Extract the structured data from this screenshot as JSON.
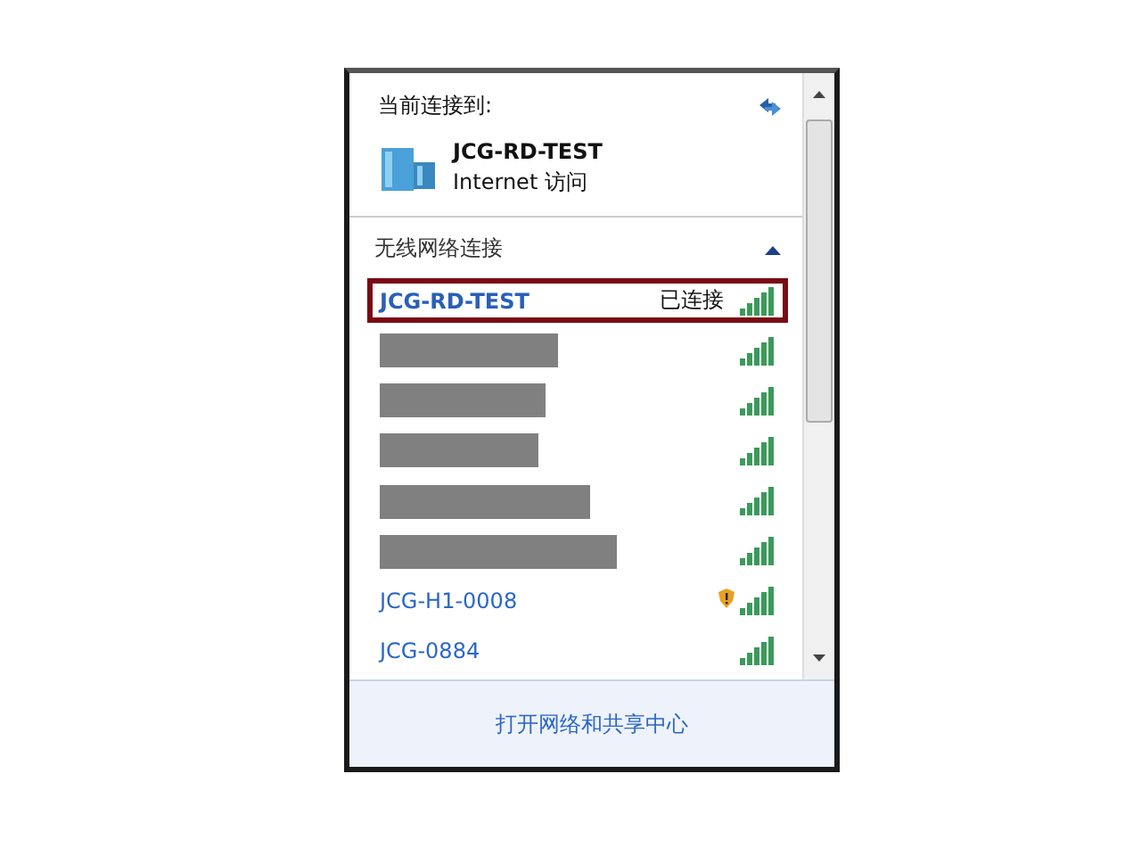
{
  "current": {
    "heading": "当前连接到:",
    "network_name": "JCG-RD-TEST",
    "access": "Internet 访问"
  },
  "section": {
    "title": "无线网络连接",
    "expanded": true
  },
  "networks": [
    {
      "kind": "named",
      "name": "JCG-RD-TEST",
      "status": "已连接",
      "selected": true,
      "warning": false
    },
    {
      "kind": "redacted",
      "selected": false,
      "warning": false
    },
    {
      "kind": "redacted",
      "selected": false,
      "warning": false
    },
    {
      "kind": "redacted",
      "selected": false,
      "warning": false
    },
    {
      "kind": "redacted",
      "selected": false,
      "warning": false
    },
    {
      "kind": "redacted",
      "selected": false,
      "warning": false
    },
    {
      "kind": "named",
      "name": "JCG-H1-0008",
      "selected": false,
      "warning": true
    },
    {
      "kind": "named",
      "name": "JCG-0884",
      "selected": false,
      "warning": false
    }
  ],
  "footer_link": "打开网络和共享中心"
}
